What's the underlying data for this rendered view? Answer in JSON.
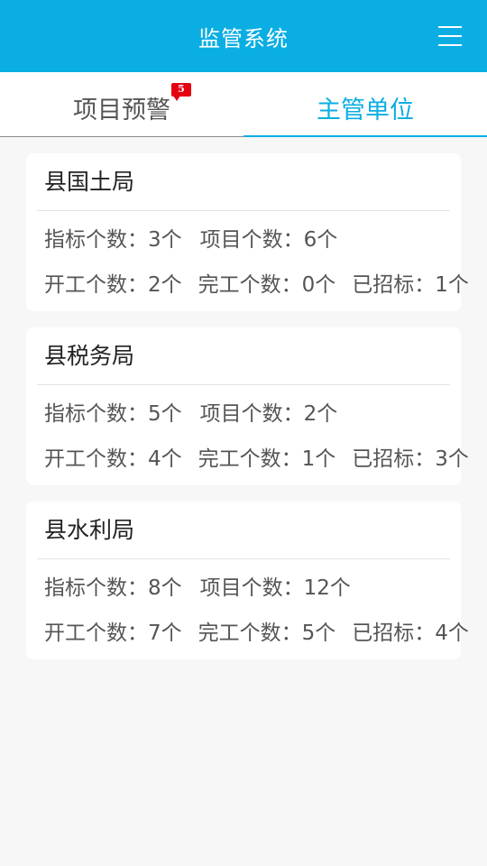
{
  "header": {
    "title": "监管系统",
    "menu_icon": "hamburger-menu-icon"
  },
  "tabs": [
    {
      "label": "项目预警",
      "badge": "5",
      "active": false
    },
    {
      "label": "主管单位",
      "active": true
    }
  ],
  "colors": {
    "primary": "#0aaee3",
    "badge": "#e50012",
    "background": "#f7f7f7"
  },
  "units": [
    {
      "name": "县国土局",
      "row1": [
        "指标个数：3个",
        "项目个数：6个"
      ],
      "row2": [
        "开工个数：2个",
        "完工个数：0个",
        "已招标：1个"
      ]
    },
    {
      "name": "县税务局",
      "row1": [
        "指标个数：5个",
        "项目个数：2个"
      ],
      "row2": [
        "开工个数：4个",
        "完工个数：1个",
        "已招标：3个"
      ]
    },
    {
      "name": "县水利局",
      "row1": [
        "指标个数：8个",
        "项目个数：12个"
      ],
      "row2": [
        "开工个数：7个",
        "完工个数：5个",
        "已招标：4个"
      ]
    }
  ]
}
